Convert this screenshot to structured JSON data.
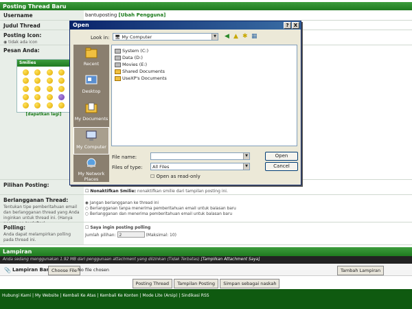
{
  "header": {
    "title": "Posting Thread Baru"
  },
  "form": {
    "username_label": "Username",
    "username_value": "bantuposting",
    "change_user_link": "[Ubah Pengguna]",
    "title_label": "Judul Thread",
    "icon_label": "Posting Icon:",
    "no_icon": "tidak ada icon",
    "message_label": "Pesan Anda:",
    "smilies_title": "Smilies",
    "more_smilies": "[dapatkan lagi]",
    "options_label": "Pilihan Posting:",
    "disable_smilies": "Nonaktifkan Smilie:",
    "disable_smilies_desc": "nonaktifkan smilie dari tampilan posting ini.",
    "subscribe_label": "Berlangganan Thread:",
    "subscribe_desc": "Tentukan tipe pemberitahuan email dan berlangganan thread yang Anda inginkan untuk thread ini. (Hanya pengguna terdaftar)",
    "sub_opt1": "Jangan berlangganan ke thread ini",
    "sub_opt2": "Berlangganan tanpa menerima pemberitahuan email untuk balasan baru",
    "sub_opt3": "Berlangganan dan menerima pemberitahuan email untuk balasan baru",
    "poll_label": "Polling:",
    "poll_desc": "Anda dapat melampirkan polling pada thread ini.",
    "poll_check": "Saya ingin posting polling",
    "poll_options_label": "Jumlah pilihan:",
    "poll_options_value": "2",
    "poll_max": "(Maksimal: 10)"
  },
  "attachments": {
    "title": "Lampiran",
    "usage_note": "Anda sedang menggunakan 1.92 MB dari penggunaan attachment yang diizinkan (Tidak Terbatas)",
    "show_link": "[Tampilkan Attachment Saya]",
    "attach_label": "Lampiran Baru:",
    "choose_file": "Choose File",
    "no_file": "No file chosen",
    "add_button": "Tambah Lampiran"
  },
  "actions": {
    "post": "Posting Thread",
    "preview": "Tampilan Posting",
    "save_draft": "Simpan sebagai naskah"
  },
  "footer": {
    "links": "Hubungi Kami | My Website | Kembali Ke Atas | Kembali Ke Konten | Mode Lite (Arsip) | Sindikasi RSS"
  },
  "dialog": {
    "title": "Open",
    "look_in_label": "Look in:",
    "look_in_value": "My Computer",
    "places": [
      "Recent",
      "Desktop",
      "My Documents",
      "My Computer",
      "My Network Places"
    ],
    "files": [
      "System (C:)",
      "Data (D:)",
      "Movies (E:)",
      "Shared Documents",
      "UseXP's Documents"
    ],
    "file_name_label": "File name:",
    "file_name_value": "",
    "files_of_type_label": "Files of type:",
    "files_of_type_value": "All Files",
    "read_only": "Open as read-only",
    "open_button": "Open",
    "cancel_button": "Cancel",
    "help": "?",
    "close": "X"
  }
}
